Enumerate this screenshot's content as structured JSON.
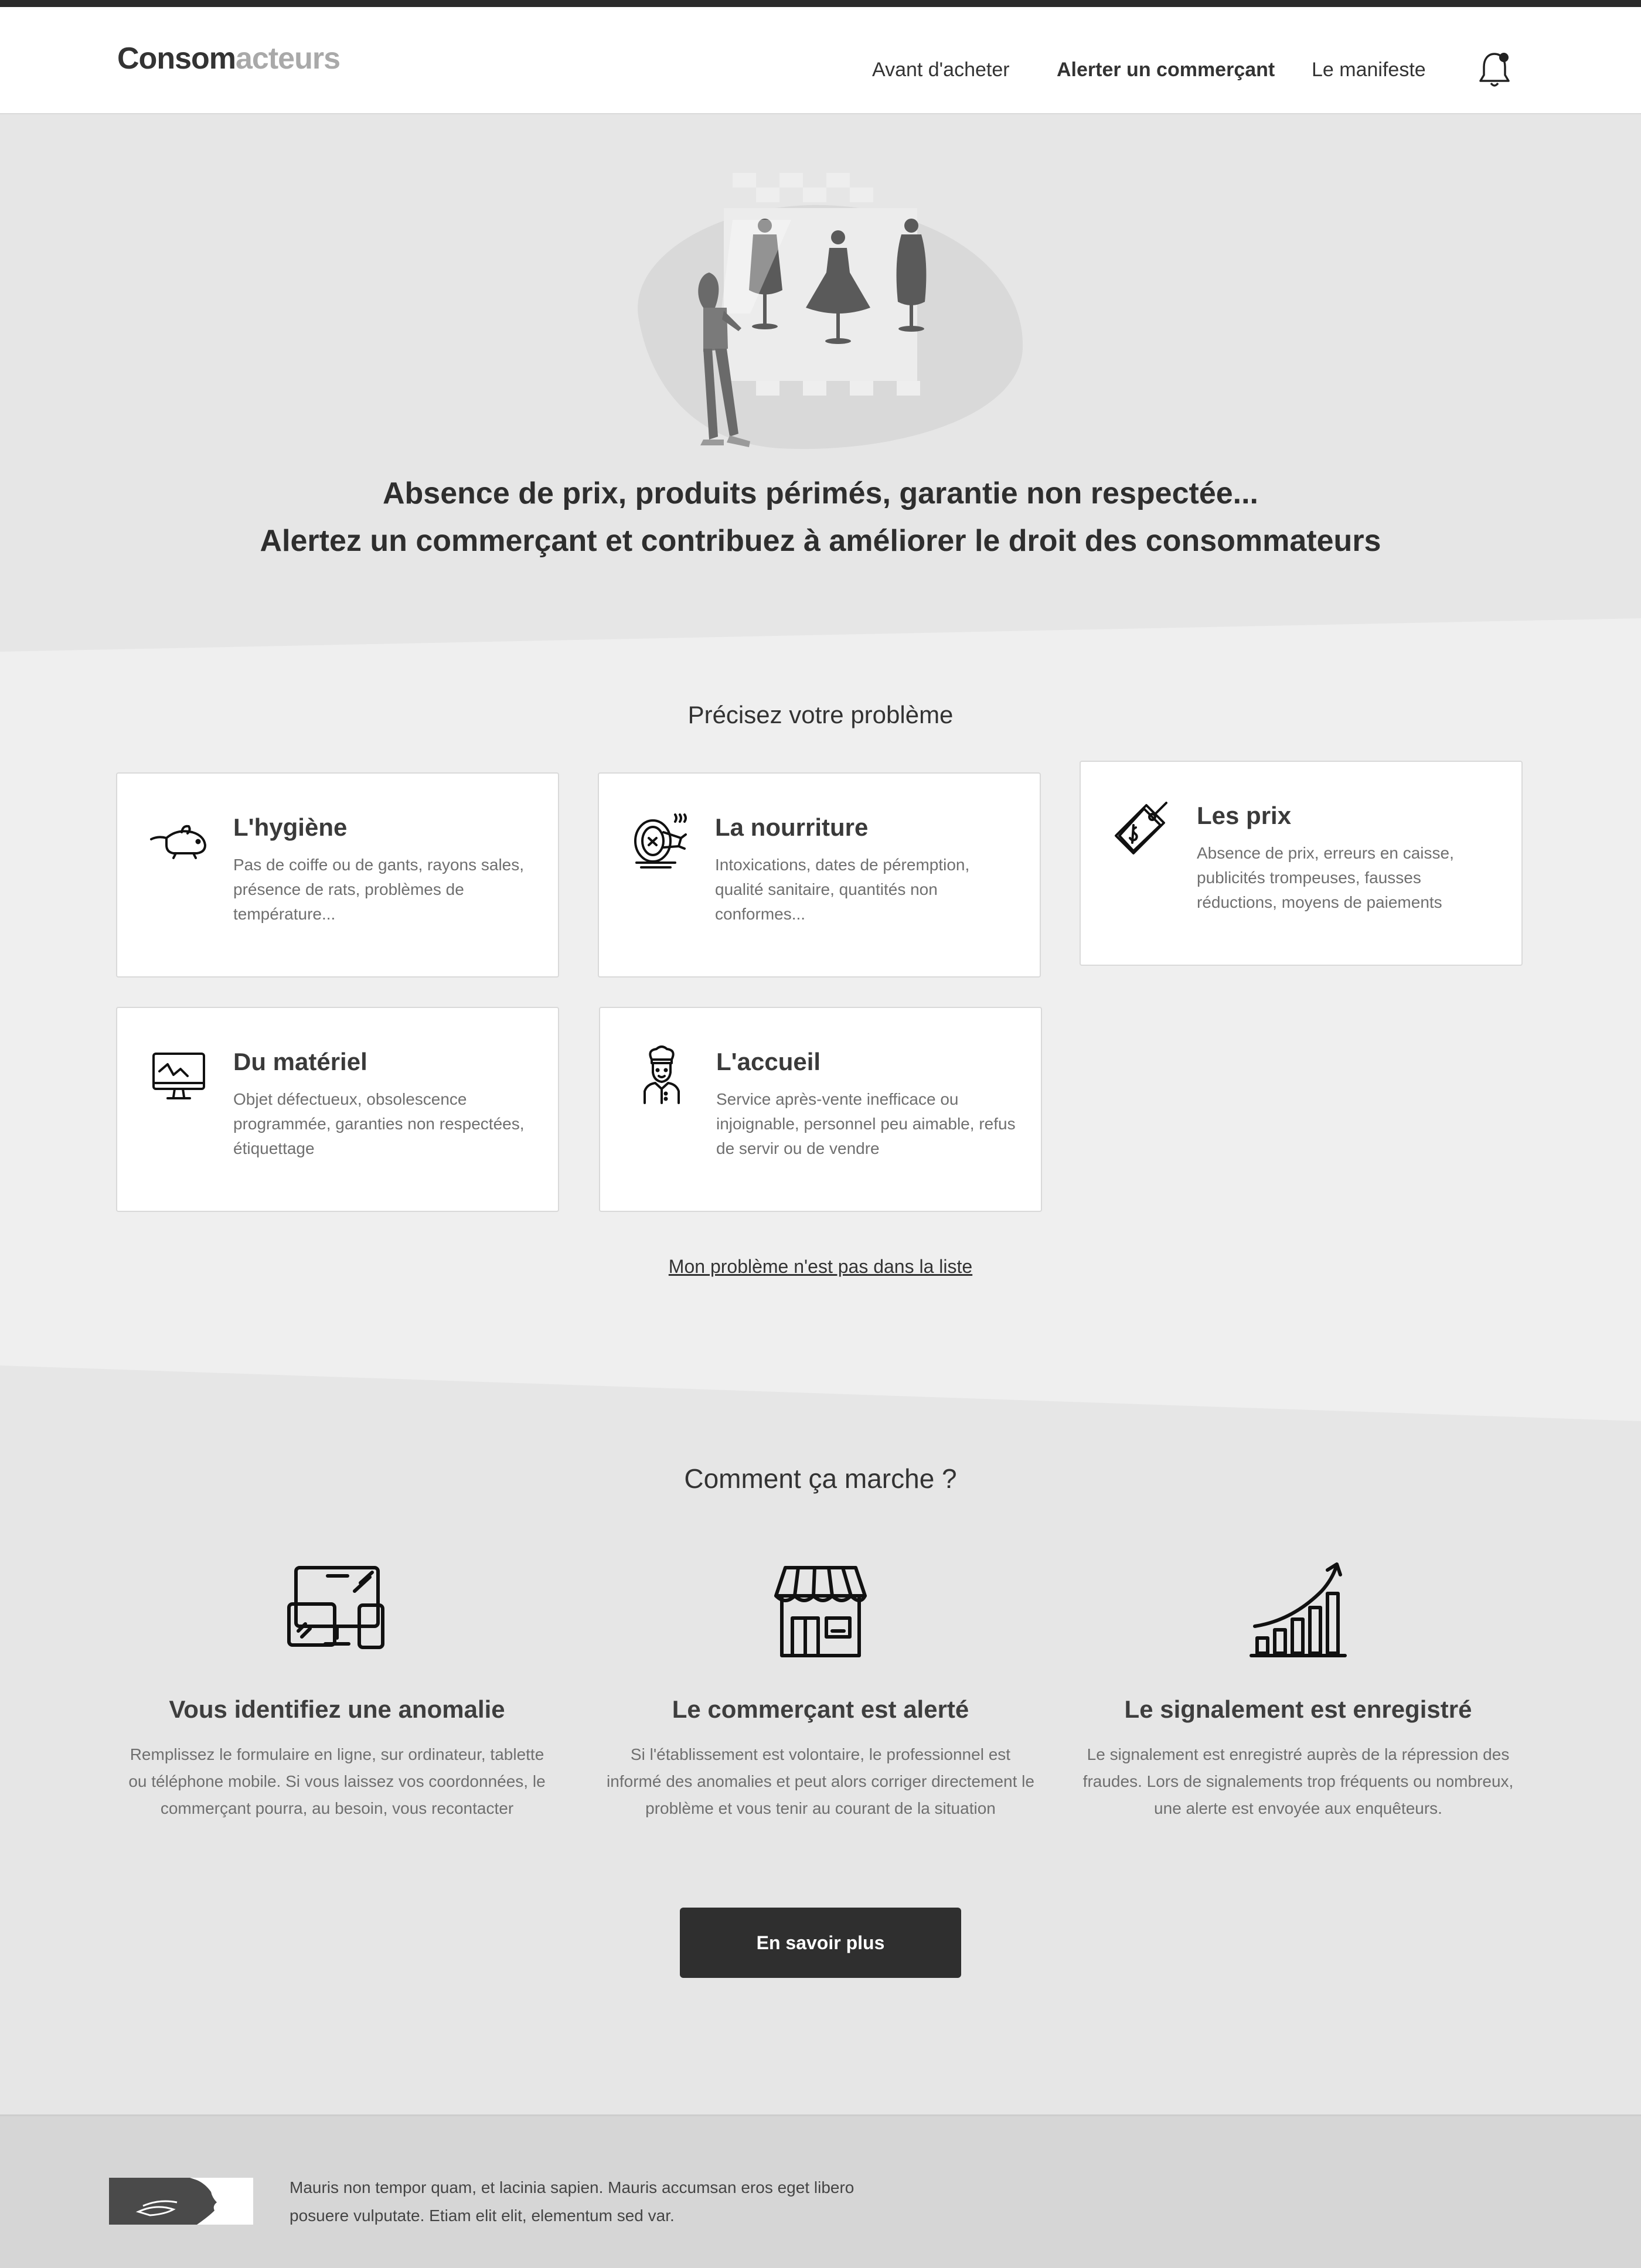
{
  "header": {
    "logo_part1": "Consom",
    "logo_part2": "acteurs",
    "nav": [
      {
        "label": "Avant d'acheter"
      },
      {
        "label": "Alerter un commerçant"
      },
      {
        "label": "Le manifeste"
      }
    ]
  },
  "hero": {
    "title_line1": "Absence de prix, produits périmés, garantie non respectée...",
    "title_line2": "Alertez un commerçant et contribuez à améliorer le droit des consommateurs"
  },
  "problems": {
    "title": "Précisez votre problème",
    "cards": [
      {
        "icon": "rat-icon",
        "title": "L'hygiène",
        "description": "Pas de coiffe ou de gants, rayons sales, présence de rats, problèmes de température..."
      },
      {
        "icon": "food-icon",
        "title": "La nourriture",
        "description": "Intoxications, dates de péremption, qualité sanitaire, quantités non conformes..."
      },
      {
        "icon": "price-tag-icon",
        "title": "Les prix",
        "description": "Absence de prix, erreurs en caisse, publicités trompeuses, fausses réductions, moyens de paiements"
      },
      {
        "icon": "monitor-icon",
        "title": "Du matériel",
        "description": "Objet défectueux, obsolescence programmée, garanties non respectées, étiquettage"
      },
      {
        "icon": "chef-icon",
        "title": "L'accueil",
        "description": "Service après-vente inefficace ou injoignable, personnel peu aimable, refus de servir ou de vendre"
      }
    ],
    "other_link": "Mon problème n'est pas dans la liste"
  },
  "how": {
    "title": "Comment ça marche ?",
    "steps": [
      {
        "icon": "devices-icon",
        "title": "Vous identifiez une anomalie",
        "description": "Remplissez le formulaire en ligne, sur ordinateur, tablette ou téléphone mobile. Si vous laissez vos coordonnées, le commerçant pourra, au besoin, vous recontacter"
      },
      {
        "icon": "shop-icon",
        "title": "Le commerçant est alerté",
        "description": "Si l'établissement est volontaire, le professionnel est informé des anomalies et peut alors corriger directement le problème et vous tenir au courant de la situation"
      },
      {
        "icon": "growth-chart-icon",
        "title": "Le signalement est enregistré",
        "description": "Le signalement est enregistré auprès de la répression des fraudes. Lors de signalements trop fréquents ou nombreux, une alerte est envoyée aux enquêteurs."
      }
    ],
    "cta_label": "En savoir plus"
  },
  "footer": {
    "text": "Mauris non tempor quam, et lacinia sapien. Mauris accumsan eros eget libero posuere vulputate. Etiam elit elit, elementum sed var."
  },
  "colors": {
    "dark": "#2f2f2f",
    "band_light": "#efefef",
    "band_gray": "#e6e6e6",
    "footer": "#d6d6d6"
  }
}
